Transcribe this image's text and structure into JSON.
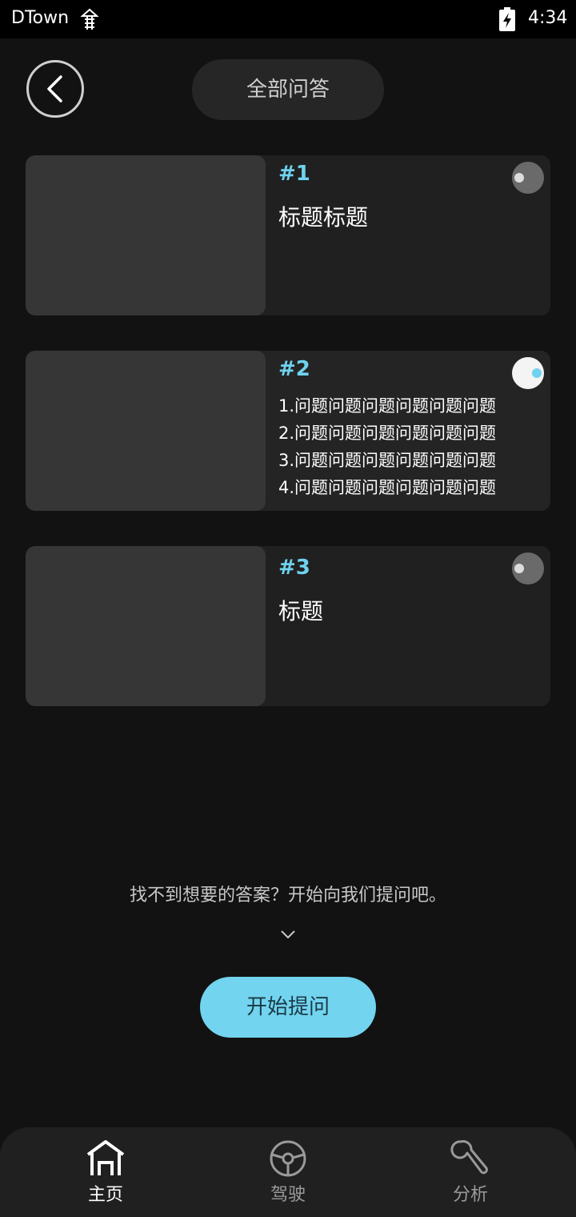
{
  "status_bar": {
    "app_name": "DTown",
    "time": "4:34",
    "icons": [
      "notification-icon",
      "battery-charging-icon"
    ]
  },
  "header": {
    "back_icon": "chevron-left-icon",
    "title": "全部问答"
  },
  "cards": [
    {
      "number": "#1",
      "title": "标题标题",
      "toggle_on": false
    },
    {
      "number": "#2",
      "items": [
        "1.问题问题问题问题问题问题",
        "2.问题问题问题问题问题问题",
        "3.问题问题问题问题问题问题",
        "4.问题问题问题问题问题问题"
      ],
      "toggle_on": true
    },
    {
      "number": "#3",
      "title": "标题",
      "toggle_on": false
    }
  ],
  "prompt": {
    "text": "找不到想要的答案？开始向我们提问吧。",
    "chevron_icon": "chevron-down-icon"
  },
  "start_button": {
    "label": "开始提问"
  },
  "bottom_nav": [
    {
      "label": "主页",
      "icon": "home-icon",
      "active": true
    },
    {
      "label": "驾驶",
      "icon": "steering-wheel-icon",
      "active": false
    },
    {
      "label": "分析",
      "icon": "wrench-icon",
      "active": false
    }
  ],
  "colors": {
    "accent": "#72d4ef",
    "background": "#121212",
    "card": "#202020",
    "thumb": "#363636"
  }
}
